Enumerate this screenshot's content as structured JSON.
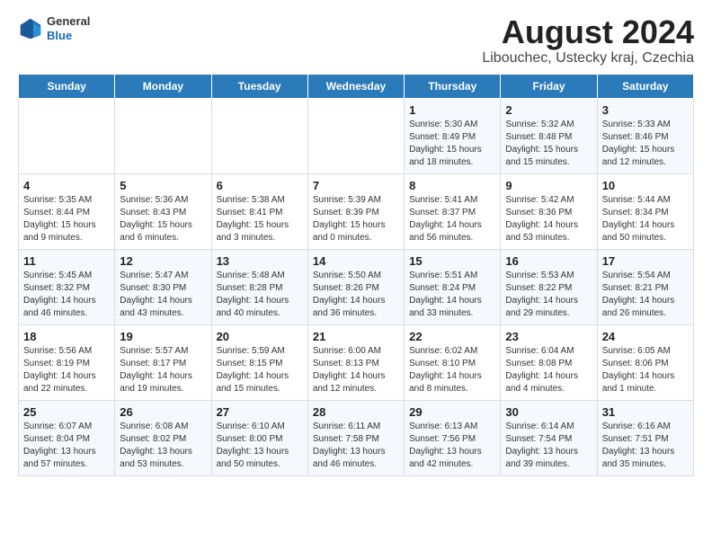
{
  "logo": {
    "general": "General",
    "blue": "Blue"
  },
  "title": "August 2024",
  "subtitle": "Libouchec, Ustecky kraj, Czechia",
  "weekdays": [
    "Sunday",
    "Monday",
    "Tuesday",
    "Wednesday",
    "Thursday",
    "Friday",
    "Saturday"
  ],
  "weeks": [
    [
      {
        "day": "",
        "info": ""
      },
      {
        "day": "",
        "info": ""
      },
      {
        "day": "",
        "info": ""
      },
      {
        "day": "",
        "info": ""
      },
      {
        "day": "1",
        "info": "Sunrise: 5:30 AM\nSunset: 8:49 PM\nDaylight: 15 hours\nand 18 minutes."
      },
      {
        "day": "2",
        "info": "Sunrise: 5:32 AM\nSunset: 8:48 PM\nDaylight: 15 hours\nand 15 minutes."
      },
      {
        "day": "3",
        "info": "Sunrise: 5:33 AM\nSunset: 8:46 PM\nDaylight: 15 hours\nand 12 minutes."
      }
    ],
    [
      {
        "day": "4",
        "info": "Sunrise: 5:35 AM\nSunset: 8:44 PM\nDaylight: 15 hours\nand 9 minutes."
      },
      {
        "day": "5",
        "info": "Sunrise: 5:36 AM\nSunset: 8:43 PM\nDaylight: 15 hours\nand 6 minutes."
      },
      {
        "day": "6",
        "info": "Sunrise: 5:38 AM\nSunset: 8:41 PM\nDaylight: 15 hours\nand 3 minutes."
      },
      {
        "day": "7",
        "info": "Sunrise: 5:39 AM\nSunset: 8:39 PM\nDaylight: 15 hours\nand 0 minutes."
      },
      {
        "day": "8",
        "info": "Sunrise: 5:41 AM\nSunset: 8:37 PM\nDaylight: 14 hours\nand 56 minutes."
      },
      {
        "day": "9",
        "info": "Sunrise: 5:42 AM\nSunset: 8:36 PM\nDaylight: 14 hours\nand 53 minutes."
      },
      {
        "day": "10",
        "info": "Sunrise: 5:44 AM\nSunset: 8:34 PM\nDaylight: 14 hours\nand 50 minutes."
      }
    ],
    [
      {
        "day": "11",
        "info": "Sunrise: 5:45 AM\nSunset: 8:32 PM\nDaylight: 14 hours\nand 46 minutes."
      },
      {
        "day": "12",
        "info": "Sunrise: 5:47 AM\nSunset: 8:30 PM\nDaylight: 14 hours\nand 43 minutes."
      },
      {
        "day": "13",
        "info": "Sunrise: 5:48 AM\nSunset: 8:28 PM\nDaylight: 14 hours\nand 40 minutes."
      },
      {
        "day": "14",
        "info": "Sunrise: 5:50 AM\nSunset: 8:26 PM\nDaylight: 14 hours\nand 36 minutes."
      },
      {
        "day": "15",
        "info": "Sunrise: 5:51 AM\nSunset: 8:24 PM\nDaylight: 14 hours\nand 33 minutes."
      },
      {
        "day": "16",
        "info": "Sunrise: 5:53 AM\nSunset: 8:22 PM\nDaylight: 14 hours\nand 29 minutes."
      },
      {
        "day": "17",
        "info": "Sunrise: 5:54 AM\nSunset: 8:21 PM\nDaylight: 14 hours\nand 26 minutes."
      }
    ],
    [
      {
        "day": "18",
        "info": "Sunrise: 5:56 AM\nSunset: 8:19 PM\nDaylight: 14 hours\nand 22 minutes."
      },
      {
        "day": "19",
        "info": "Sunrise: 5:57 AM\nSunset: 8:17 PM\nDaylight: 14 hours\nand 19 minutes."
      },
      {
        "day": "20",
        "info": "Sunrise: 5:59 AM\nSunset: 8:15 PM\nDaylight: 14 hours\nand 15 minutes."
      },
      {
        "day": "21",
        "info": "Sunrise: 6:00 AM\nSunset: 8:13 PM\nDaylight: 14 hours\nand 12 minutes."
      },
      {
        "day": "22",
        "info": "Sunrise: 6:02 AM\nSunset: 8:10 PM\nDaylight: 14 hours\nand 8 minutes."
      },
      {
        "day": "23",
        "info": "Sunrise: 6:04 AM\nSunset: 8:08 PM\nDaylight: 14 hours\nand 4 minutes."
      },
      {
        "day": "24",
        "info": "Sunrise: 6:05 AM\nSunset: 8:06 PM\nDaylight: 14 hours\nand 1 minute."
      }
    ],
    [
      {
        "day": "25",
        "info": "Sunrise: 6:07 AM\nSunset: 8:04 PM\nDaylight: 13 hours\nand 57 minutes."
      },
      {
        "day": "26",
        "info": "Sunrise: 6:08 AM\nSunset: 8:02 PM\nDaylight: 13 hours\nand 53 minutes."
      },
      {
        "day": "27",
        "info": "Sunrise: 6:10 AM\nSunset: 8:00 PM\nDaylight: 13 hours\nand 50 minutes."
      },
      {
        "day": "28",
        "info": "Sunrise: 6:11 AM\nSunset: 7:58 PM\nDaylight: 13 hours\nand 46 minutes."
      },
      {
        "day": "29",
        "info": "Sunrise: 6:13 AM\nSunset: 7:56 PM\nDaylight: 13 hours\nand 42 minutes."
      },
      {
        "day": "30",
        "info": "Sunrise: 6:14 AM\nSunset: 7:54 PM\nDaylight: 13 hours\nand 39 minutes."
      },
      {
        "day": "31",
        "info": "Sunrise: 6:16 AM\nSunset: 7:51 PM\nDaylight: 13 hours\nand 35 minutes."
      }
    ]
  ]
}
